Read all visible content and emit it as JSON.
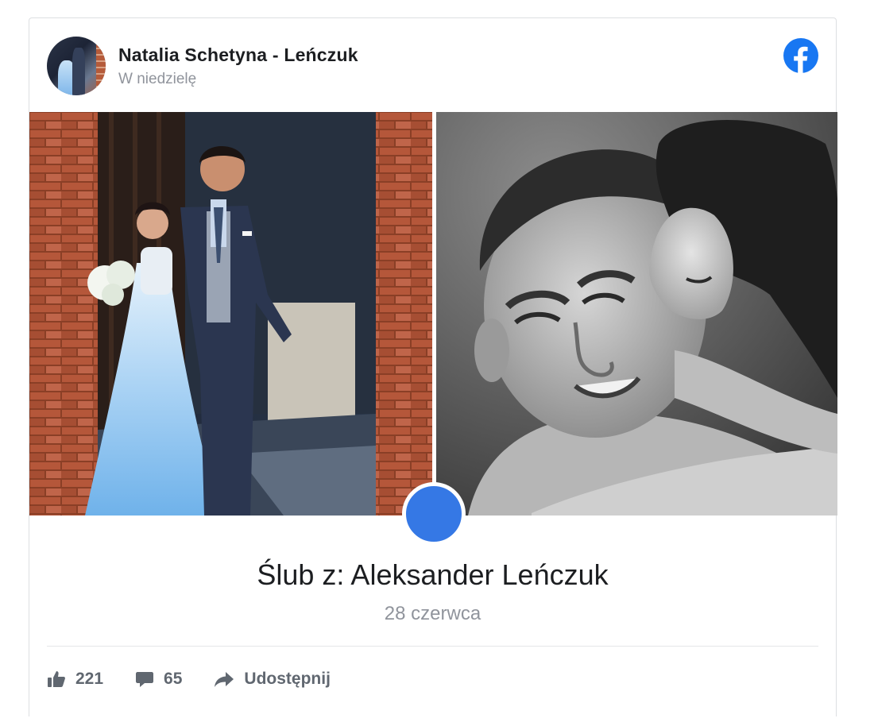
{
  "post": {
    "author": "Natalia Schetyna - Leńczuk",
    "time": "W niedzielę",
    "platform_icon": "facebook-logo-icon",
    "brand_color": "#1877f2"
  },
  "event": {
    "title": "Ślub z: Aleksander Leńczuk",
    "date": "28 czerwca",
    "icon_color": "#3578e5"
  },
  "actions": {
    "likes": "221",
    "comments": "65",
    "share_label": "Udostępnij"
  }
}
